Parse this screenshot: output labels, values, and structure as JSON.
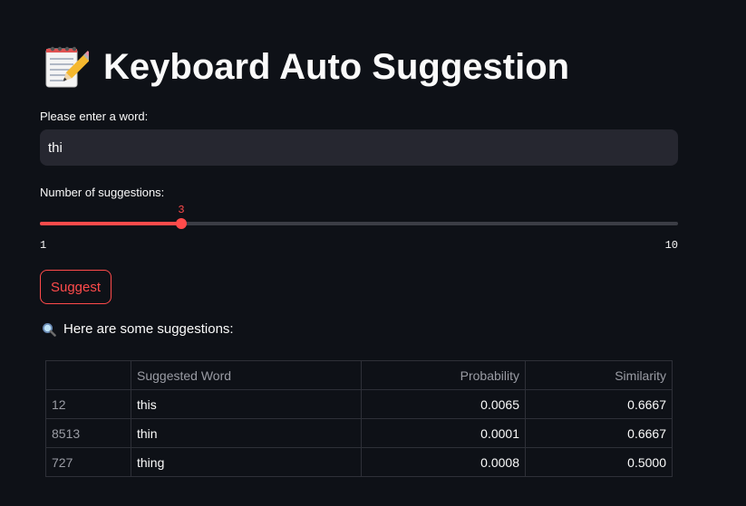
{
  "app": {
    "title": "Keyboard Auto Suggestion",
    "title_icon": "memo-pencil-icon"
  },
  "word_input": {
    "label": "Please enter a word:",
    "value": "thi"
  },
  "suggestion_slider": {
    "label": "Number of suggestions:",
    "value": 3,
    "value_text": "3",
    "min": 1,
    "min_text": "1",
    "max": 10,
    "max_text": "10",
    "accent_color": "#ff4b4b"
  },
  "suggest_button": {
    "label": "Suggest"
  },
  "results": {
    "icon": "magnifier-icon",
    "message": "Here are some suggestions:",
    "columns": [
      "",
      "Suggested Word",
      "Probability",
      "Similarity"
    ],
    "rows": [
      {
        "index": "12",
        "word": "this",
        "probability": "0.0065",
        "similarity": "0.6667"
      },
      {
        "index": "8513",
        "word": "thin",
        "probability": "0.0001",
        "similarity": "0.6667"
      },
      {
        "index": "727",
        "word": "thing",
        "probability": "0.0008",
        "similarity": "0.5000"
      }
    ]
  },
  "colors": {
    "background": "#0e1117",
    "input_background": "#262730",
    "accent": "#ff4b4b",
    "text": "#fafafa"
  }
}
